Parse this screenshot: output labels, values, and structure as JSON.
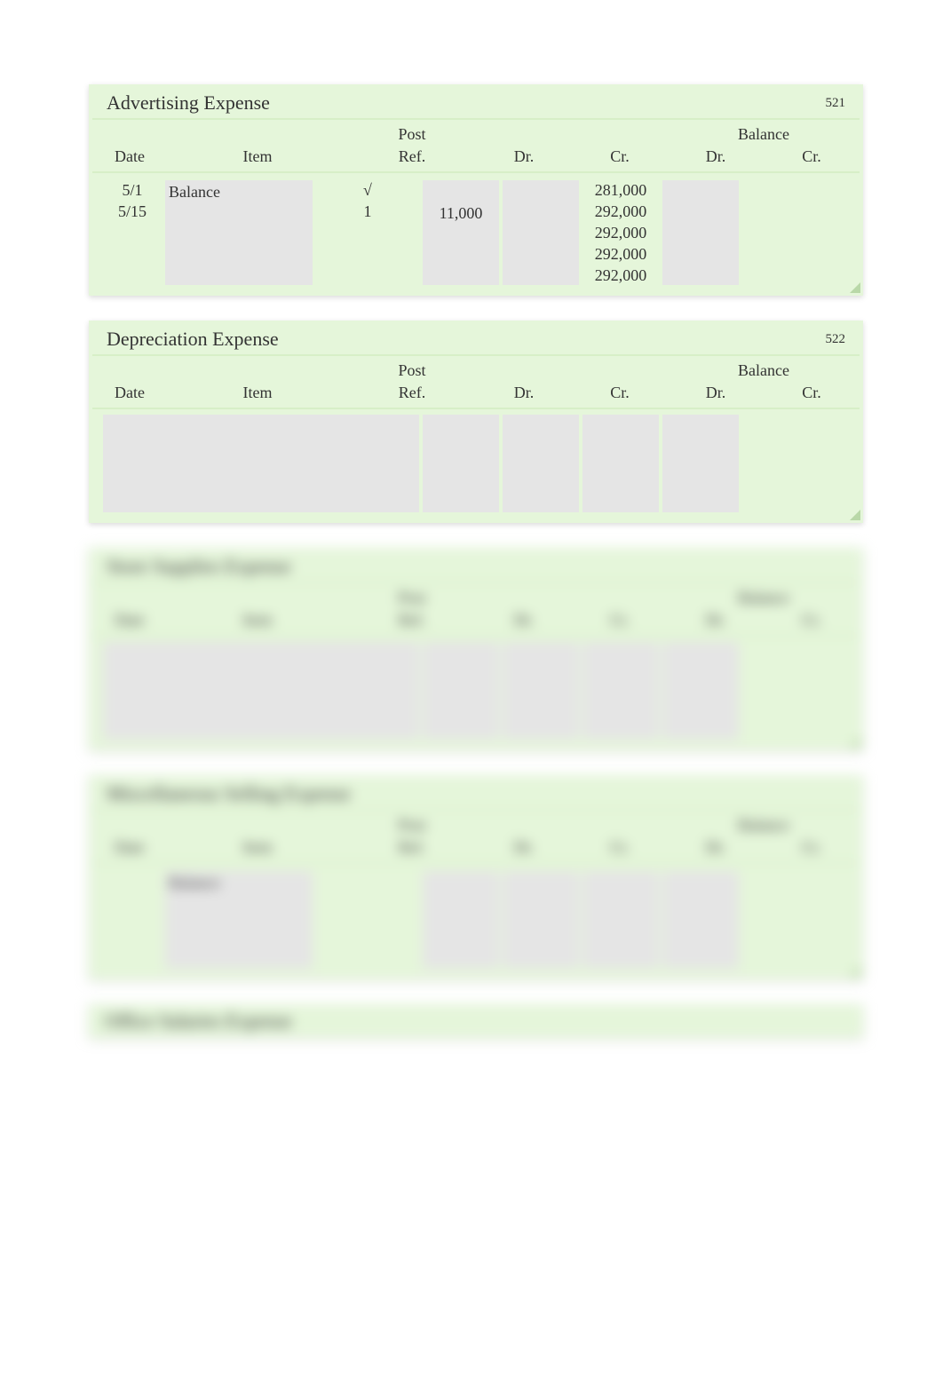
{
  "headers": {
    "post_top": "Post",
    "post_bot": "Ref.",
    "balance": "Balance",
    "date": "Date",
    "item": "Item",
    "dr": "Dr.",
    "cr": "Cr."
  },
  "ledgers": [
    {
      "title": "Advertising Expense",
      "account_no": "521",
      "rows_date": [
        "5/1",
        "5/15",
        "",
        "",
        ""
      ],
      "rows_item": [
        "Balance",
        "",
        "",
        "",
        ""
      ],
      "rows_post": [
        "√",
        "1",
        "",
        "",
        ""
      ],
      "rows_dr": [
        "",
        "11,000",
        "",
        "",
        ""
      ],
      "rows_cr": [
        "",
        "",
        "",
        "",
        ""
      ],
      "rows_bdr": [
        "281,000",
        "292,000",
        "292,000",
        "292,000",
        "292,000"
      ],
      "rows_bcr": [
        "",
        "",
        "",
        "",
        ""
      ]
    },
    {
      "title": "Depreciation Expense",
      "account_no": "522",
      "rows_date": [],
      "rows_item": [],
      "rows_post": [],
      "rows_dr": [],
      "rows_cr": [],
      "rows_bdr": [],
      "rows_bcr": []
    },
    {
      "title": "Store Supplies Expense",
      "account_no": "",
      "rows_date": [],
      "rows_item": [],
      "rows_post": [],
      "rows_dr": [],
      "rows_cr": [],
      "rows_bdr": [],
      "rows_bcr": []
    },
    {
      "title": "Miscellaneous Selling Expense",
      "account_no": "",
      "rows_date": [
        "",
        "",
        "",
        ""
      ],
      "rows_item": [
        "Balance",
        "",
        "",
        ""
      ],
      "rows_post": [
        "",
        "",
        "",
        ""
      ],
      "rows_dr": [
        "",
        "",
        "",
        ""
      ],
      "rows_cr": [
        "",
        "",
        "",
        ""
      ],
      "rows_bdr": [
        "",
        "",
        "",
        ""
      ],
      "rows_bcr": [
        "",
        "",
        "",
        ""
      ]
    }
  ],
  "stub": {
    "title": "Office Salaries Expense",
    "account_no": ""
  }
}
